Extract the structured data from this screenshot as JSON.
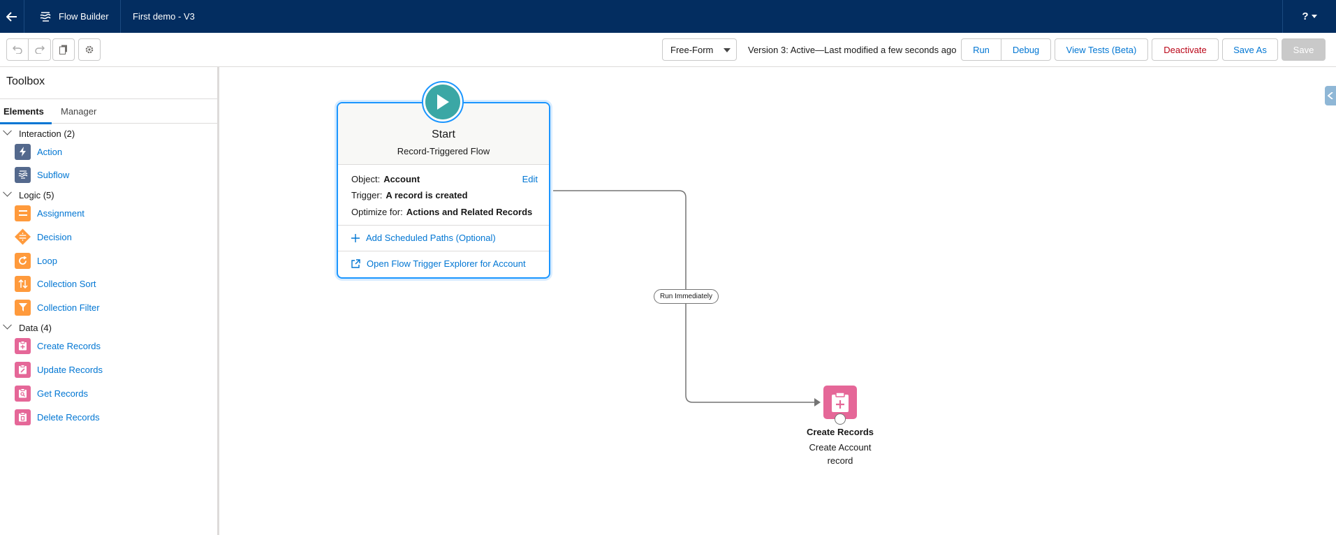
{
  "header": {
    "app_title": "Flow Builder",
    "flow_name": "First demo - V3",
    "help_label": "?"
  },
  "toolbar": {
    "layout_mode": "Free-Form",
    "version_status": "Version 3: Active—Last modified a few seconds ago",
    "run_label": "Run",
    "debug_label": "Debug",
    "view_tests_label": "View Tests (Beta)",
    "deactivate_label": "Deactivate",
    "save_as_label": "Save As",
    "save_label": "Save"
  },
  "sidebar": {
    "title": "Toolbox",
    "tabs": [
      {
        "label": "Elements",
        "active": true
      },
      {
        "label": "Manager",
        "active": false
      }
    ],
    "groups": [
      {
        "label": "Interaction (2)",
        "items": [
          {
            "label": "Action",
            "icon": "lightning-icon"
          },
          {
            "label": "Subflow",
            "icon": "subflow-icon"
          }
        ]
      },
      {
        "label": "Logic (5)",
        "items": [
          {
            "label": "Assignment",
            "icon": "assignment-icon"
          },
          {
            "label": "Decision",
            "icon": "decision-icon"
          },
          {
            "label": "Loop",
            "icon": "loop-icon"
          },
          {
            "label": "Collection Sort",
            "icon": "sort-icon"
          },
          {
            "label": "Collection Filter",
            "icon": "filter-icon"
          }
        ]
      },
      {
        "label": "Data (4)",
        "items": [
          {
            "label": "Create Records",
            "icon": "create-records-icon"
          },
          {
            "label": "Update Records",
            "icon": "update-records-icon"
          },
          {
            "label": "Get Records",
            "icon": "get-records-icon"
          },
          {
            "label": "Delete Records",
            "icon": "delete-records-icon"
          }
        ]
      }
    ]
  },
  "canvas": {
    "start": {
      "title": "Start",
      "subtitle": "Record-Triggered Flow",
      "object_label": "Object:",
      "object_value": "Account",
      "edit_label": "Edit",
      "trigger_label": "Trigger:",
      "trigger_value": "A record is created",
      "optimize_label": "Optimize for:",
      "optimize_value": "Actions and Related Records",
      "add_paths_label": "Add Scheduled Paths (Optional)",
      "explorer_label": "Open Flow Trigger Explorer for Account"
    },
    "connector_label": "Run Immediately",
    "create_records": {
      "title": "Create Records",
      "subtitle": "Create Account record"
    }
  },
  "colors": {
    "header_bg": "#032d60",
    "accent": "#0176d3",
    "start_node": "#3ba7a5",
    "logic": "#ff9a3c",
    "data": "#e56798",
    "interaction": "#54698d",
    "destructive": "#ba0517"
  }
}
